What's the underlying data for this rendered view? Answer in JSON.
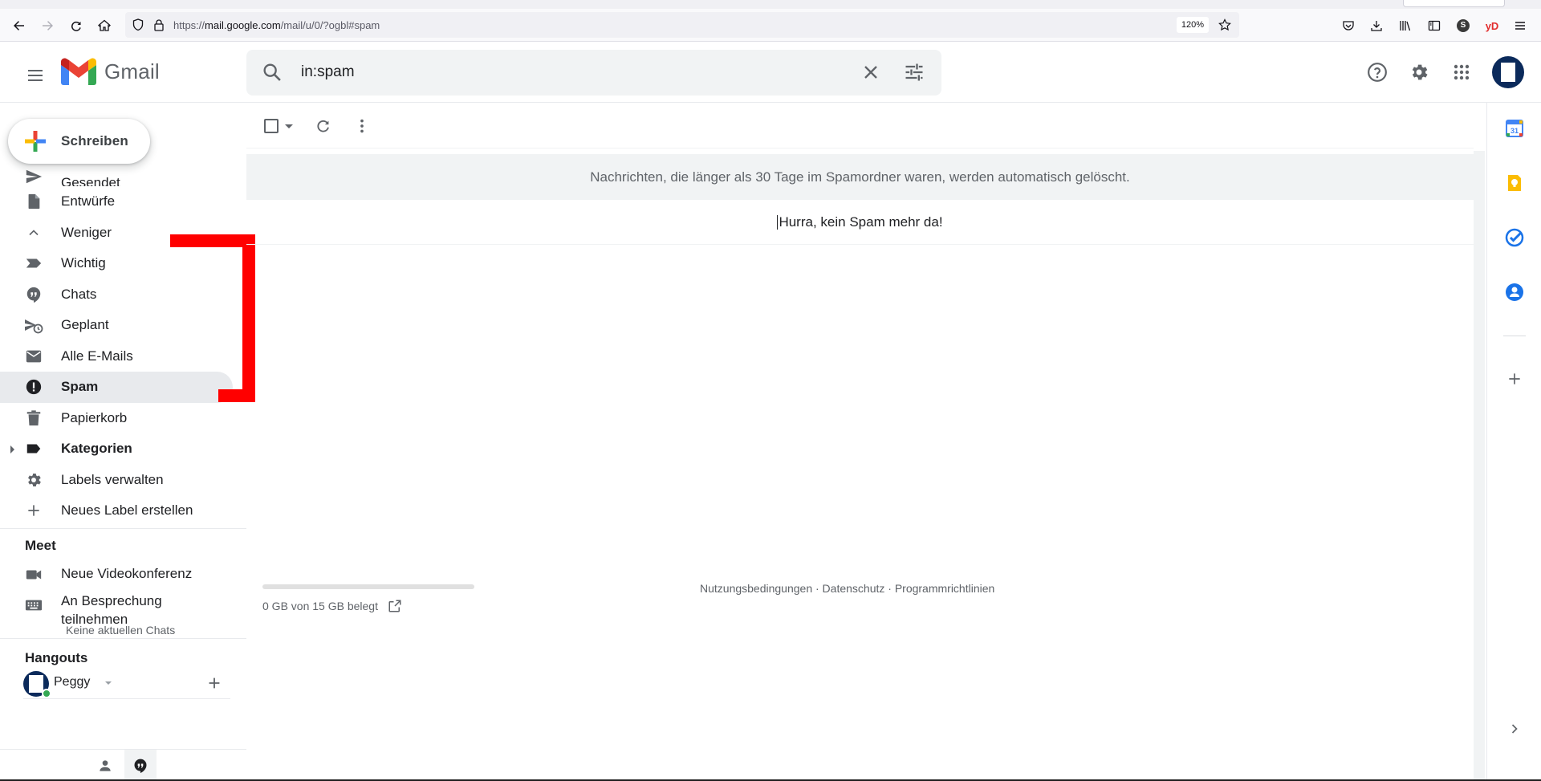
{
  "browser": {
    "url_prefix": "https://",
    "url_host": "mail.google.com",
    "url_path": "/mail/u/0/?ogbl#spam",
    "zoom": "120%",
    "profile_initial": "S",
    "yd_label": "yD"
  },
  "header": {
    "app_name": "Gmail",
    "search_value": "in:spam"
  },
  "sidebar": {
    "compose_label": "Schreiben",
    "partial_item": "Gesendet",
    "items": [
      {
        "label": "Entwürfe",
        "icon": "draft-icon"
      },
      {
        "label": "Weniger",
        "icon": "chevron-up-icon"
      },
      {
        "label": "Wichtig",
        "icon": "important-icon"
      },
      {
        "label": "Chats",
        "icon": "chat-icon"
      },
      {
        "label": "Geplant",
        "icon": "scheduled-icon"
      },
      {
        "label": "Alle E-Mails",
        "icon": "all-mail-icon"
      },
      {
        "label": "Spam",
        "icon": "spam-icon",
        "active": true
      },
      {
        "label": "Papierkorb",
        "icon": "trash-icon"
      },
      {
        "label": "Kategorien",
        "icon": "label-icon"
      },
      {
        "label": "Labels verwalten",
        "icon": "gear-icon"
      },
      {
        "label": "Neues Label erstellen",
        "icon": "plus-icon"
      }
    ],
    "meet": {
      "title": "Meet",
      "new_meeting": "Neue Videokonferenz",
      "join_meeting": "An Besprechung teilnehmen"
    },
    "hangouts": {
      "title": "Hangouts",
      "user": "Peggy",
      "no_chats": "Keine aktuellen Chats"
    }
  },
  "main": {
    "spam_notice": "Nachrichten, die länger als 30 Tage im Spamordner waren, werden automatisch gelöscht.",
    "empty_message": "Hurra, kein Spam mehr da!",
    "storage": "0 GB von 15 GB belegt",
    "storage_fraction": 0.0,
    "footer": "Nutzungsbedingungen · Datenschutz · Programmrichtlinien"
  },
  "side_panel": {
    "calendar_day": "31"
  },
  "colors": {
    "gmail_red": "#ea4335",
    "gmail_blue": "#4285f4",
    "gmail_green": "#34a853",
    "gmail_yellow": "#fbbc04",
    "annotation_red": "#ff0000"
  }
}
